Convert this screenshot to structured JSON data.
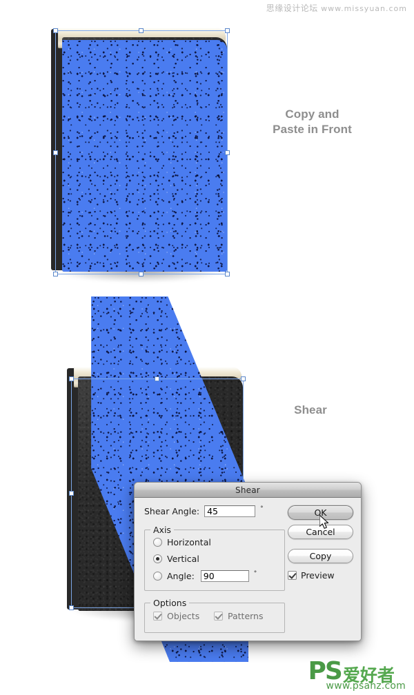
{
  "watermarks": {
    "top": "思缘设计论坛",
    "top_domain": "www.missyuan.com",
    "bottom_brand": "PS",
    "bottom_brand_cn": "爱好者",
    "bottom_url": "www.psahz.com"
  },
  "annotations": {
    "step1_label": "Copy and\nPaste in Front",
    "step1_line1": "Copy and",
    "step1_line2": "Paste in Front",
    "step2_label": "Shear"
  },
  "dialog": {
    "title": "Shear",
    "shear_angle_label": "Shear Angle:",
    "shear_angle_value": "45",
    "degree_symbol": "°",
    "axis_group_label": "Axis",
    "axis_options": [
      {
        "label": "Horizontal",
        "selected": false
      },
      {
        "label": "Vertical",
        "selected": true
      }
    ],
    "angle_label": "Angle:",
    "angle_selected": false,
    "angle_value": "90",
    "options_group_label": "Options",
    "options": [
      {
        "label": "Objects",
        "checked": true,
        "enabled": false
      },
      {
        "label": "Patterns",
        "checked": true,
        "enabled": false
      }
    ],
    "buttons": {
      "ok": "OK",
      "cancel": "Cancel",
      "copy": "Copy"
    },
    "preview": {
      "label": "Preview",
      "checked": true
    }
  },
  "canvas": {
    "selection_color": "#7da7e8",
    "shape_fill": "#4a7cf0",
    "cover_color": "#2b2b2b",
    "pages_color": "#e8e0cb"
  }
}
